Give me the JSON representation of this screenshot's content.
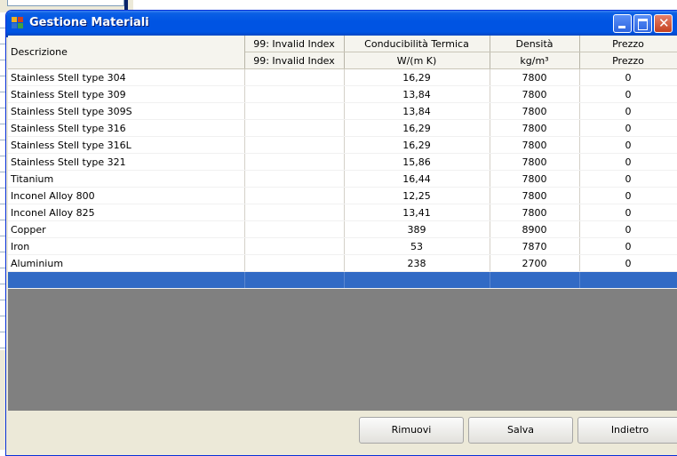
{
  "window": {
    "title": "Gestione Materiali",
    "icon": "app-window-icon"
  },
  "grid": {
    "header_row1": [
      "Descrizione",
      "99: Invalid Index",
      "Conducibilità Termica",
      "Densità",
      "Prezzo"
    ],
    "header_row2": [
      "99: Invalid Index",
      "W/(m K)",
      "kg/m³",
      "Prezzo"
    ],
    "rows": [
      [
        "Stainless Stell type 304",
        "",
        "16,29",
        "7800",
        "0"
      ],
      [
        "Stainless Stell type 309",
        "",
        "13,84",
        "7800",
        "0"
      ],
      [
        "Stainless Stell type 309S",
        "",
        "13,84",
        "7800",
        "0"
      ],
      [
        "Stainless Stell type 316",
        "",
        "16,29",
        "7800",
        "0"
      ],
      [
        "Stainless Stell type 316L",
        "",
        "16,29",
        "7800",
        "0"
      ],
      [
        "Stainless Stell type 321",
        "",
        "15,86",
        "7800",
        "0"
      ],
      [
        "Titanium",
        "",
        "16,44",
        "7800",
        "0"
      ],
      [
        "Inconel Alloy 800",
        "",
        "12,25",
        "7800",
        "0"
      ],
      [
        "Inconel Alloy 825",
        "",
        "13,41",
        "7800",
        "0"
      ],
      [
        "Copper",
        "",
        "389",
        "8900",
        "0"
      ],
      [
        "Iron",
        "",
        "53",
        "7870",
        "0"
      ],
      [
        "Aluminium",
        "",
        "238",
        "2700",
        "0"
      ]
    ]
  },
  "buttons": {
    "remove": "Rimuovi",
    "save": "Salva",
    "back": "Indietro"
  },
  "colors": {
    "titlebar": "#0054e3",
    "selection": "#316ac5",
    "grid_background": "#808080"
  }
}
